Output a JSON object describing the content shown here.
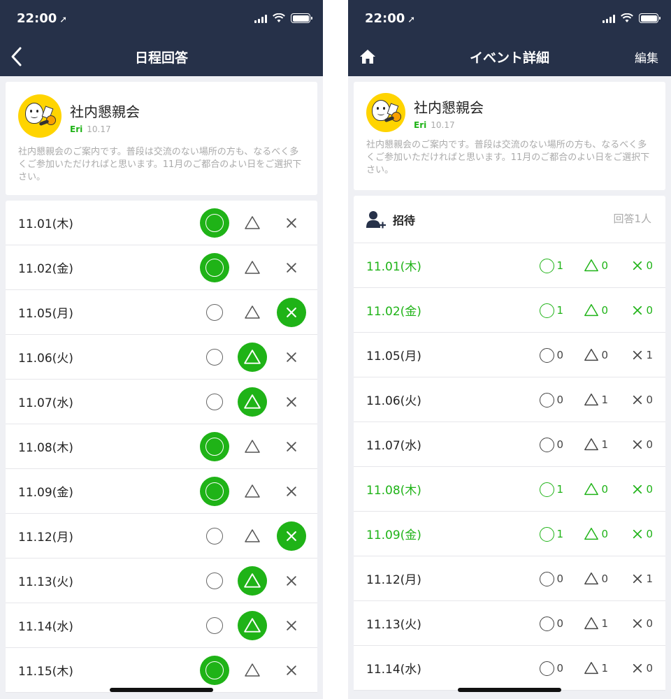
{
  "colors": {
    "header": "#263149",
    "accent": "#1fb317",
    "muted": "#aaaaaa"
  },
  "status": {
    "time": "22:00"
  },
  "left": {
    "nav_title": "日程回答",
    "event": {
      "title": "社内懇親会",
      "author": "Eri",
      "date": "10.17",
      "description": "社内懇親会のご案内です。普段は交流のない場所の方も、なるべく多くご参加いただければと思います。11月のご都合のよい日をご選択下さい。"
    },
    "rows": [
      {
        "date": "11.01(木)",
        "selected": "circle"
      },
      {
        "date": "11.02(金)",
        "selected": "circle"
      },
      {
        "date": "11.05(月)",
        "selected": "x"
      },
      {
        "date": "11.06(火)",
        "selected": "triangle"
      },
      {
        "date": "11.07(水)",
        "selected": "triangle"
      },
      {
        "date": "11.08(木)",
        "selected": "circle"
      },
      {
        "date": "11.09(金)",
        "selected": "circle"
      },
      {
        "date": "11.12(月)",
        "selected": "x"
      },
      {
        "date": "11.13(火)",
        "selected": "triangle"
      },
      {
        "date": "11.14(水)",
        "selected": "triangle"
      },
      {
        "date": "11.15(木)",
        "selected": "circle"
      }
    ]
  },
  "right": {
    "nav_title": "イベント詳細",
    "edit_label": "編集",
    "event": {
      "title": "社内懇親会",
      "author": "Eri",
      "date": "10.17",
      "description": "社内懇親会のご案内です。普段は交流のない場所の方も、なるべく多くご参加いただければと思います。11月のご都合のよい日をご選択下さい。"
    },
    "invite_label": "招待",
    "answer_count": "回答1人",
    "rows": [
      {
        "date": "11.01(木)",
        "circle": "1",
        "triangle": "0",
        "x": "0",
        "highlight": true
      },
      {
        "date": "11.02(金)",
        "circle": "1",
        "triangle": "0",
        "x": "0",
        "highlight": true
      },
      {
        "date": "11.05(月)",
        "circle": "0",
        "triangle": "0",
        "x": "1",
        "highlight": false
      },
      {
        "date": "11.06(火)",
        "circle": "0",
        "triangle": "1",
        "x": "0",
        "highlight": false
      },
      {
        "date": "11.07(水)",
        "circle": "0",
        "triangle": "1",
        "x": "0",
        "highlight": false
      },
      {
        "date": "11.08(木)",
        "circle": "1",
        "triangle": "0",
        "x": "0",
        "highlight": true
      },
      {
        "date": "11.09(金)",
        "circle": "1",
        "triangle": "0",
        "x": "0",
        "highlight": true
      },
      {
        "date": "11.12(月)",
        "circle": "0",
        "triangle": "0",
        "x": "1",
        "highlight": false
      },
      {
        "date": "11.13(火)",
        "circle": "0",
        "triangle": "1",
        "x": "0",
        "highlight": false
      },
      {
        "date": "11.14(水)",
        "circle": "0",
        "triangle": "1",
        "x": "0",
        "highlight": false
      }
    ]
  }
}
